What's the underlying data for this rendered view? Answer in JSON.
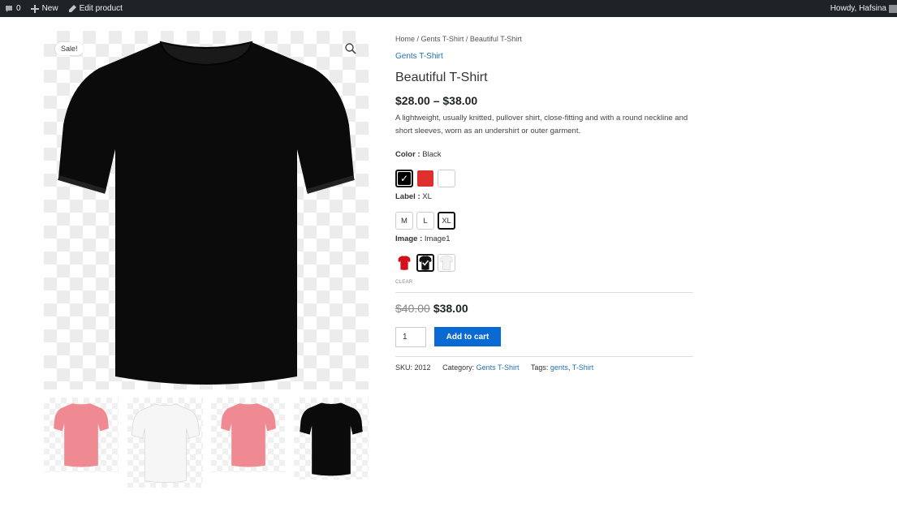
{
  "adminbar": {
    "comments_count": "0",
    "new_label": "New",
    "edit_label": "Edit product",
    "howdy": "Howdy, Hafsina"
  },
  "gallery": {
    "sale_badge": "Sale!",
    "main_color": "#0b0b0b",
    "thumbnails": [
      {
        "color": "#f08a92",
        "name": "pink"
      },
      {
        "color": "#f6f6f6",
        "name": "white"
      },
      {
        "color": "#f08a92",
        "name": "pink"
      },
      {
        "color": "#0b0b0b",
        "name": "black"
      }
    ]
  },
  "product": {
    "breadcrumb": "Home / Gents T-Shirt / Beautiful T-Shirt",
    "category_link": "Gents T-Shirt",
    "title": "Beautiful T-Shirt",
    "price_range": "$28.00 – $38.00",
    "description": "A lightweight, usually knitted, pullover shirt, close-fitting and with a round neckline and short sleeves, worn as an undershirt or outer garment."
  },
  "attributes": {
    "color": {
      "label": "Color :",
      "value": "Black",
      "options": [
        "#000000",
        "#e0302e",
        "#ffffff"
      ],
      "selected_index": 0
    },
    "label": {
      "label": "Label :",
      "value": "XL",
      "options": [
        "M",
        "L",
        "XL"
      ],
      "selected_index": 2
    },
    "image": {
      "label": "Image :",
      "value": "Image1",
      "options": [
        "red-shirt",
        "black-shirt",
        "white-shirt"
      ],
      "selected_index": 1
    },
    "clear_label": "CLEAR"
  },
  "variation": {
    "old_price": "$40.00",
    "new_price": "$38.00",
    "quantity": "1",
    "add_to_cart": "Add to cart"
  },
  "meta": {
    "sku_label": "SKU:",
    "sku": "2012",
    "category_label": "Category:",
    "category": "Gents T-Shirt",
    "tags_label": "Tags:",
    "tag1": "gents",
    "tag2": "T-Shirt"
  },
  "colors": {
    "adminbar_bg": "#1d2327",
    "link": "#2271b1",
    "button": "#0a6ad3"
  }
}
